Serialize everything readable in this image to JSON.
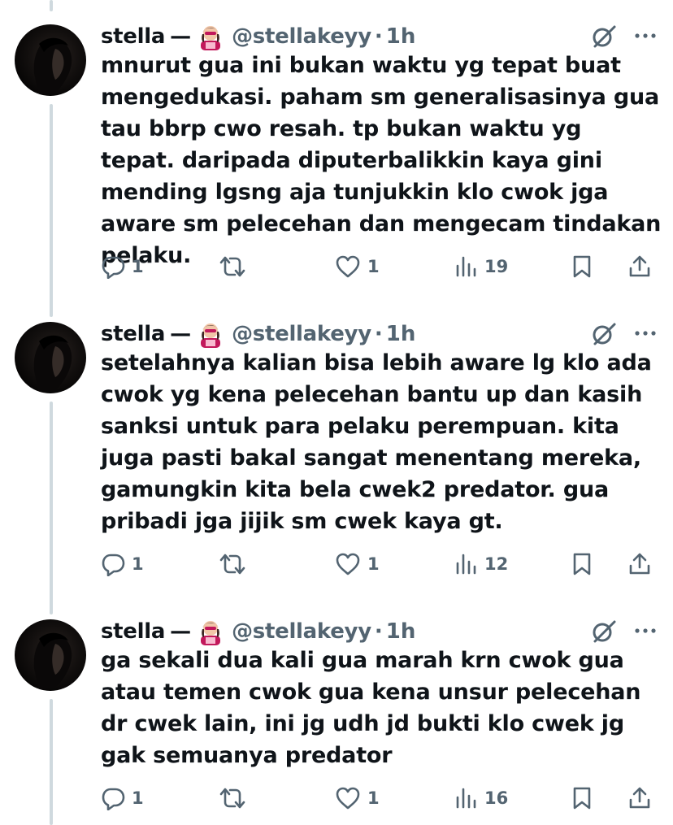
{
  "tweets": [
    {
      "name": "stella",
      "separator": "—",
      "handle": "@stellakeyy",
      "dot": "·",
      "time": "1h",
      "text": "mnurut gua ini bukan waktu yg tepat buat mengedukasi. paham sm generalisasinya gua tau bbrp cwo resah. tp bukan waktu yg tepat. daripada diputerbalikkin kaya gini mending lgsng aja tunjukkin klo cwok jga aware sm pelecehan dan mengecam tindakan pelaku.",
      "replies": "1",
      "retweets": "",
      "likes": "1",
      "views": "19"
    },
    {
      "name": "stella",
      "separator": "—",
      "handle": "@stellakeyy",
      "dot": "·",
      "time": "1h",
      "text": "setelahnya kalian bisa lebih aware lg klo ada cwok yg kena pelecehan bantu up dan kasih sanksi untuk para pelaku perempuan. kita juga pasti bakal sangat menentang mereka, gamungkin kita bela cwek2 predator. gua pribadi jga jijik sm cwek kaya gt.",
      "replies": "1",
      "retweets": "",
      "likes": "1",
      "views": "12"
    },
    {
      "name": "stella",
      "separator": "—",
      "handle": "@stellakeyy",
      "dot": "·",
      "time": "1h",
      "text": "ga sekali dua kali gua marah krn cwok gua atau temen cwok gua kena unsur pelecehan dr cwek lain, ini jg udh jd bukti klo cwek jg gak semuanya predator",
      "replies": "1",
      "retweets": "",
      "likes": "1",
      "views": "16"
    }
  ],
  "icons": {
    "emoji": "woman-superhero-emoji",
    "grok": "grok-icon",
    "more": "more-icon",
    "reply": "reply-icon",
    "retweet": "retweet-icon",
    "like": "like-icon",
    "views": "views-icon",
    "bookmark": "bookmark-icon",
    "share": "share-icon"
  },
  "colors": {
    "text": "#0f1419",
    "muted": "#536471",
    "thread_line": "#cfd9de",
    "background": "#ffffff"
  }
}
